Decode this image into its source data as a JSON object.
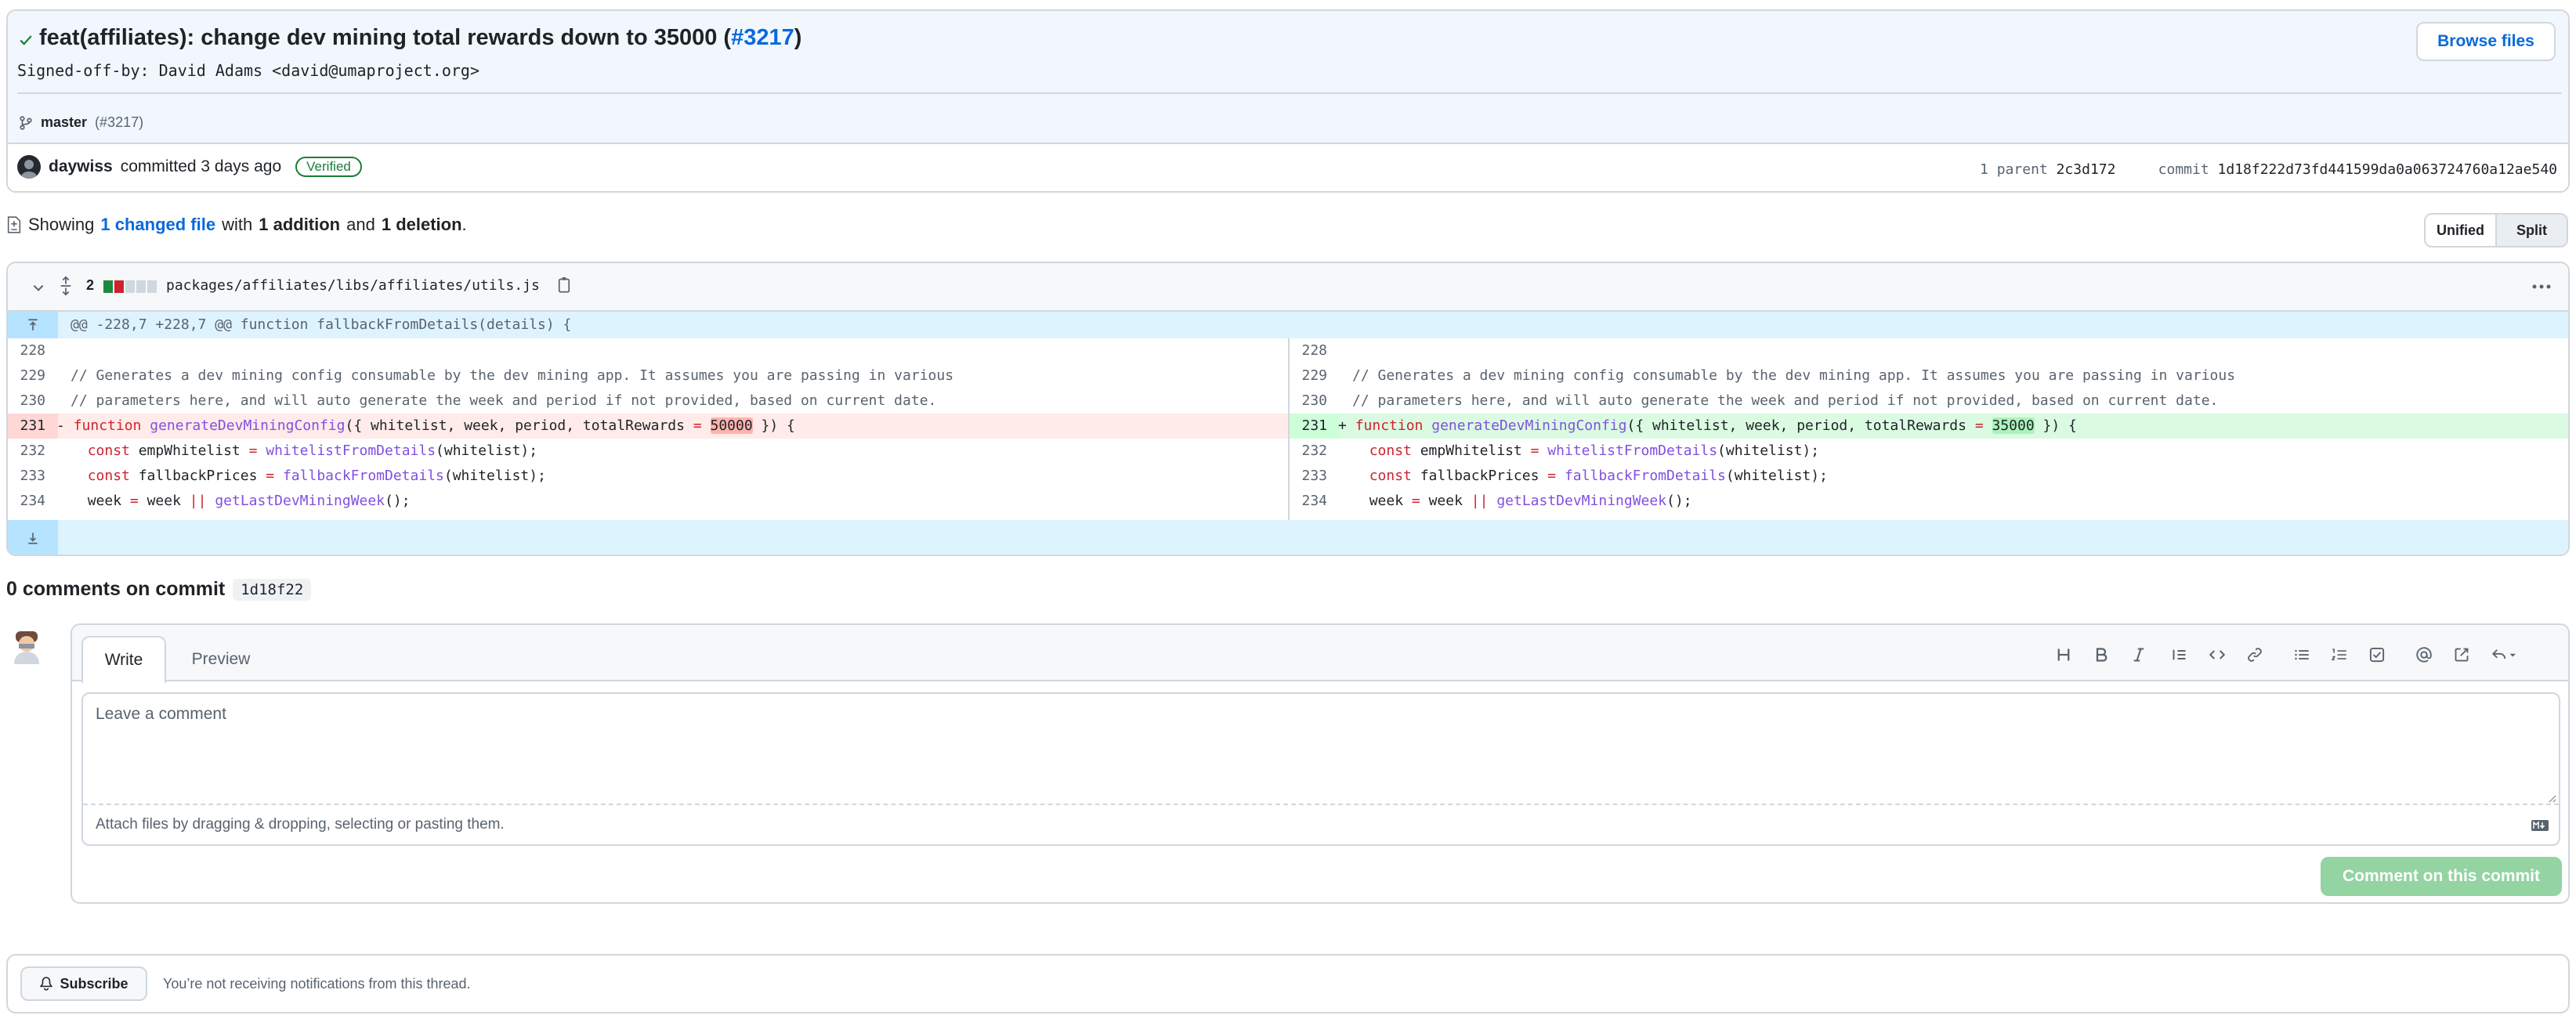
{
  "commit": {
    "title_text": "feat(affiliates): change dev mining total rewards down to 35000 (",
    "pr_link": "#3217",
    "title_close": ")",
    "signed_off": "Signed-off-by: David Adams <david@umaproject.org>",
    "branch": "master",
    "branch_pr": "(#3217)",
    "author": "daywiss",
    "action": "committed 3 days ago",
    "verified": "Verified",
    "parent_label": "1 parent",
    "parent_sha": "2c3d172",
    "commit_label": "commit",
    "commit_sha": "1d18f222d73fd441599da0a063724760a12ae540",
    "browse_files": "Browse files"
  },
  "summary": {
    "showing": "Showing",
    "changed": "1 changed file",
    "with": "with",
    "additions": "1 addition",
    "and": "and",
    "deletions": "1 deletion",
    "period": ".",
    "unified": "Unified",
    "split": "Split"
  },
  "diff": {
    "changes": "2",
    "path": "packages/affiliates/libs/affiliates/utils.js",
    "hunk": "@@ -228,7 +228,7 @@ function fallbackFromDetails(details) {",
    "left": {
      "lines": [
        {
          "n": "228",
          "t": ""
        },
        {
          "n": "229",
          "t": "// Generates a dev mining config consumable by the dev mining app. It assumes you are passing in various"
        },
        {
          "n": "230",
          "t": "// parameters here, and will auto generate the week and period if not provided, based on current date."
        },
        {
          "n": "231",
          "sign": "-",
          "kw": "function",
          "fn": "generateDevMiningConfig",
          "pre": "({ whitelist, week, period, totalRewards ",
          "op": "=",
          "num": "50000",
          "post": " }) {"
        },
        {
          "n": "232",
          "kw": "const",
          "var": "empWhitelist",
          "op": "=",
          "fn": "whitelistFromDetails",
          "post": "(whitelist);"
        },
        {
          "n": "233",
          "kw": "const",
          "var": "fallbackPrices",
          "op": "=",
          "fn": "fallbackFromDetails",
          "post": "(whitelist);"
        },
        {
          "n": "234",
          "var": "week",
          "op": "=",
          "mid": "week",
          "op2": "||",
          "fn": "getLastDevMiningWeek",
          "post": "();"
        }
      ]
    },
    "right": {
      "lines": [
        {
          "n": "228",
          "t": ""
        },
        {
          "n": "229",
          "t": "// Generates a dev mining config consumable by the dev mining app. It assumes you are passing in various"
        },
        {
          "n": "230",
          "t": "// parameters here, and will auto generate the week and period if not provided, based on current date."
        },
        {
          "n": "231",
          "sign": "+",
          "kw": "function",
          "fn": "generateDevMiningConfig",
          "pre": "({ whitelist, week, period, totalRewards ",
          "op": "=",
          "num": "35000",
          "post": " }) {"
        },
        {
          "n": "232",
          "kw": "const",
          "var": "empWhitelist",
          "op": "=",
          "fn": "whitelistFromDetails",
          "post": "(whitelist);"
        },
        {
          "n": "233",
          "kw": "const",
          "var": "fallbackPrices",
          "op": "=",
          "fn": "fallbackFromDetails",
          "post": "(whitelist);"
        },
        {
          "n": "234",
          "var": "week",
          "op": "=",
          "mid": "week",
          "op2": "||",
          "fn": "getLastDevMiningWeek",
          "post": "();"
        }
      ]
    }
  },
  "comments": {
    "title": "0 comments on commit",
    "sha": "1d18f22",
    "tab_write": "Write",
    "tab_preview": "Preview",
    "placeholder": "Leave a comment",
    "attach": "Attach files by dragging & dropping, selecting or pasting them.",
    "submit": "Comment on this commit",
    "tools": [
      "heading-icon",
      "bold-icon",
      "italic-icon",
      "quote-icon",
      "code-icon",
      "link-icon",
      "unordered-list-icon",
      "ordered-list-icon",
      "task-list-icon",
      "mention-icon",
      "reference-icon",
      "reply-icon"
    ]
  },
  "subscribe": {
    "button": "Subscribe",
    "text": "You’re not receiving notifications from this thread."
  },
  "colors": {
    "accent": "#0969da",
    "deletion_bg": "#ffebe9",
    "addition_bg": "#dafbe1",
    "verified": "#1a7f37",
    "submit_disabled": "#94d3a2"
  }
}
